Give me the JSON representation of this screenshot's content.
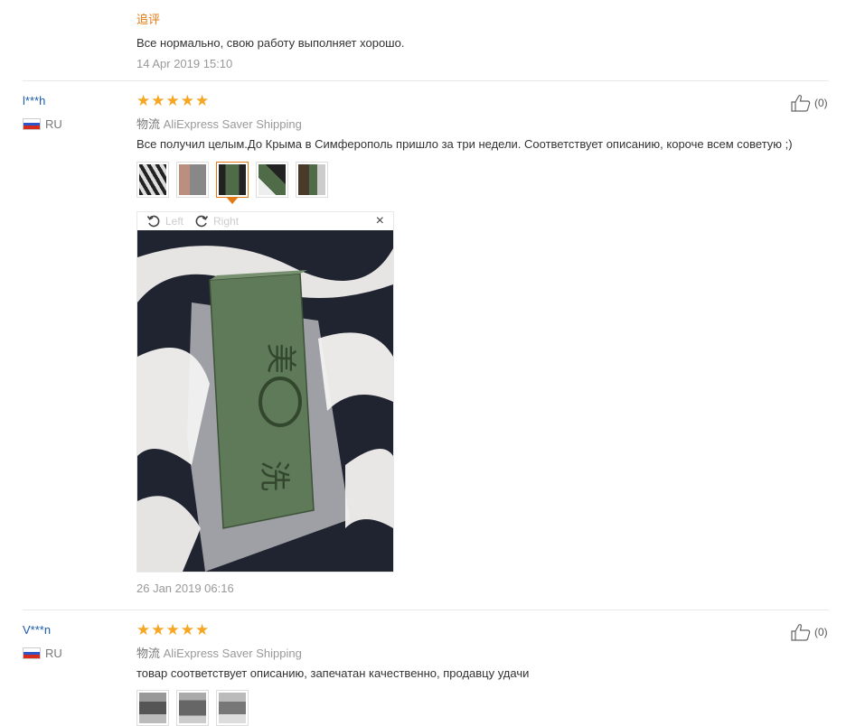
{
  "review0": {
    "followup_label": "追评",
    "followup_text": "Все нормально, свою работу выполняет хорошо.",
    "followup_date": "14 Apr 2019 15:10"
  },
  "review1": {
    "username": "l***h",
    "country": "RU",
    "rating": 5,
    "shipping_label": "物流",
    "shipping_method": "AliExpress Saver Shipping",
    "text": "Все получил целым.До Крыма в Симферополь пришло за три недели. Соответствует описанию, короче всем советую ;)",
    "likes": "(0)",
    "viewer": {
      "left_label": "Left",
      "right_label": "Right",
      "close": "×"
    },
    "date": "26 Jan 2019 06:16"
  },
  "review2": {
    "username": "V***n",
    "country": "RU",
    "rating": 5,
    "shipping_label": "物流",
    "shipping_method": "AliExpress Saver Shipping",
    "text": "товар соответствует описанию, запечатан качественно, продавцу удачи",
    "likes": "(0)"
  },
  "icons": [
    "star-icon",
    "thumbs-up-icon",
    "rotate-left-icon",
    "rotate-right-icon",
    "close-icon",
    "flag-ru-icon"
  ],
  "colors": {
    "accent": "#e47911",
    "star": "#f5a623",
    "username": "#1c5ba8"
  }
}
